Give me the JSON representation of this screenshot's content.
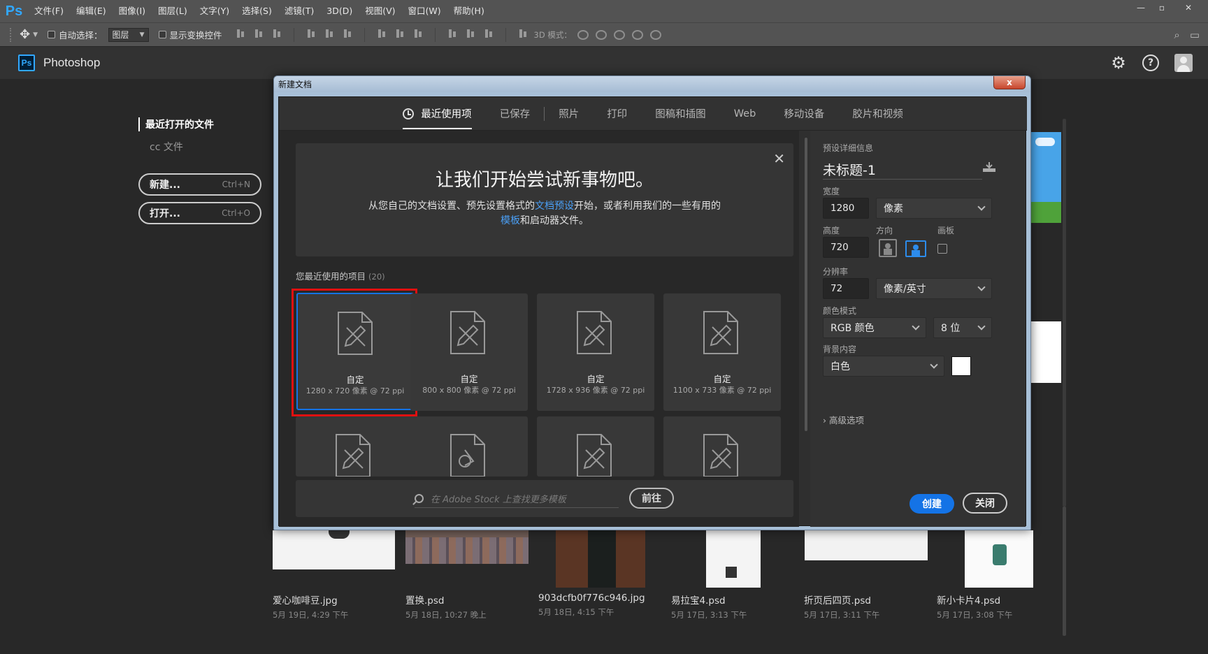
{
  "menubar": {
    "logo": "Ps",
    "items": [
      "文件(F)",
      "编辑(E)",
      "图像(I)",
      "图层(L)",
      "文字(Y)",
      "选择(S)",
      "滤镜(T)",
      "3D(D)",
      "视图(V)",
      "窗口(W)",
      "帮助(H)"
    ]
  },
  "options": {
    "auto_select_label": "自动选择：",
    "auto_select_value": "图层",
    "show_transform_label": "显示变换控件",
    "mode3d_label": "3D 模式："
  },
  "home": {
    "logo": "Ps",
    "title": "Photoshop",
    "nav": [
      "最近打开的文件",
      "cc 文件"
    ],
    "new_label": "新建...",
    "new_shortcut": "Ctrl+N",
    "open_label": "打开...",
    "open_shortcut": "Ctrl+O",
    "recent_files": [
      {
        "name": "爱心咖啡豆.jpg",
        "date": "5月 19日, 4:29 下午"
      },
      {
        "name": "置换.psd",
        "date": "5月 18日, 10:27 晚上"
      },
      {
        "name": "903dcfb0f776c946.jpg",
        "date": "5月 18日, 4:15 下午"
      },
      {
        "name": "易拉宝4.psd",
        "date": "5月 17日, 3:13 下午"
      },
      {
        "name": "折页后四页.psd",
        "date": "5月 17日, 3:11 下午"
      },
      {
        "name": "新小卡片4.psd",
        "date": "5月 17日, 3:08 下午"
      }
    ]
  },
  "dialog": {
    "title": "新建文档",
    "close_glyph": "x",
    "tabs": [
      "最近使用项",
      "已保存",
      "照片",
      "打印",
      "图稿和插图",
      "Web",
      "移动设备",
      "胶片和视频"
    ],
    "welcome": {
      "title": "让我们开始尝试新事物吧。",
      "text_1": "从您自己的文档设置、预先设置格式的",
      "link_1": "文档预设",
      "text_2": "开始，或者利用我们的一些有用的",
      "link_2": "模板",
      "text_3": "和启动器文件。"
    },
    "recent_label": "您最近使用的项目",
    "recent_count": "(20)",
    "presets": [
      {
        "name": "自定",
        "size": "1280 x 720 像素 @ 72 ppi"
      },
      {
        "name": "自定",
        "size": "800 x 800 像素 @ 72 ppi"
      },
      {
        "name": "自定",
        "size": "1728 x 936 像素 @ 72 ppi"
      },
      {
        "name": "自定",
        "size": "1100 x 733 像素 @ 72 ppi"
      }
    ],
    "stock_placeholder": "在 Adobe Stock 上查找更多模板",
    "stock_go": "前往",
    "details": {
      "section_label": "预设详细信息",
      "doc_name": "未标题-1",
      "width_label": "宽度",
      "width_value": "1280",
      "width_unit": "像素",
      "height_label": "高度",
      "height_value": "720",
      "orientation_label": "方向",
      "artboard_label": "画板",
      "resolution_label": "分辨率",
      "resolution_value": "72",
      "resolution_unit": "像素/英寸",
      "color_mode_label": "颜色模式",
      "color_mode_value": "RGB 颜色",
      "bit_depth": "8 位",
      "background_label": "背景内容",
      "background_value": "白色",
      "background_color": "#ffffff",
      "advanced_label": "高级选项",
      "create_label": "创建",
      "close_label": "关闭"
    }
  },
  "colors": {
    "accent": "#1473e6",
    "link": "#4a9ff5",
    "highlight_frame": "#e01010",
    "ps_blue": "#31a8ff"
  }
}
